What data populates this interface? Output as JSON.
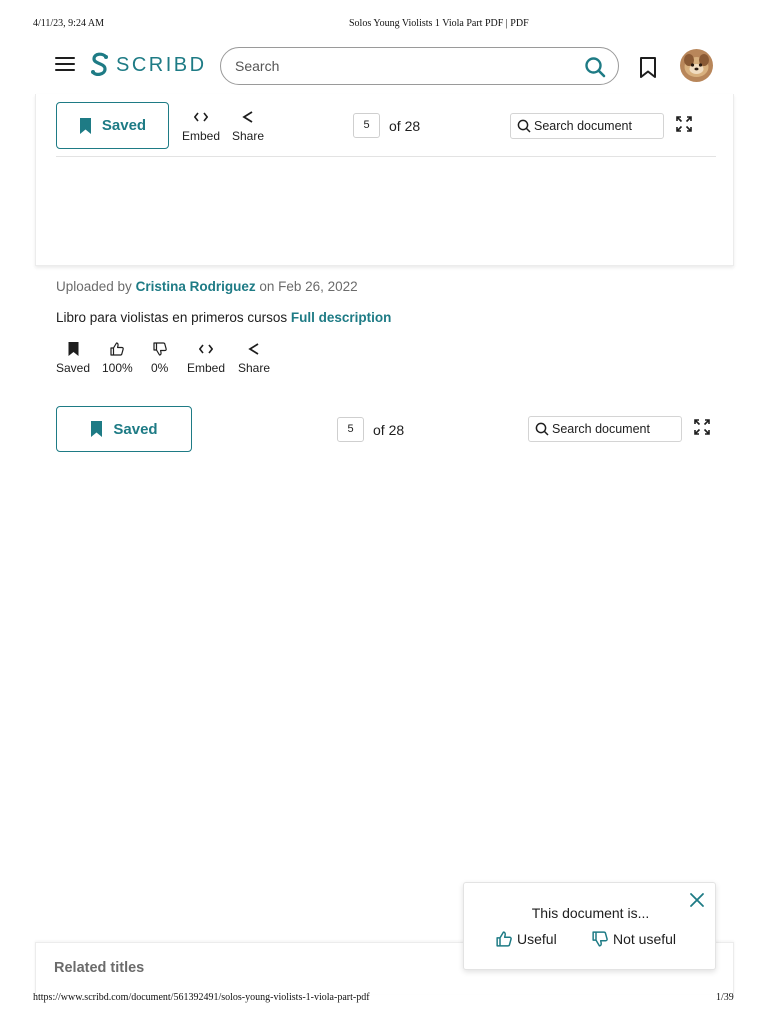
{
  "print_header": {
    "datetime": "4/11/23, 9:24 AM",
    "title": "Solos Young Violists 1 Viola Part PDF | PDF"
  },
  "print_footer": {
    "url": "https://www.scribd.com/document/561392491/solos-young-violists-1-viola-part-pdf",
    "page": "1/39"
  },
  "header": {
    "logo_text": "SCRIBD",
    "search_placeholder": "Search"
  },
  "toolbar_top": {
    "saved_label": "Saved",
    "embed_label": "Embed",
    "share_label": "Share",
    "page_current": "5",
    "page_total": "of 28",
    "search_doc_label": "Search document"
  },
  "meta": {
    "uploaded_prefix": "Uploaded by",
    "uploader": "Cristina Rodriguez",
    "date_text": "on Feb 26, 2022",
    "description": "Libro para violistas en primeros cursos",
    "full_description": "Full description"
  },
  "actions": {
    "saved": "Saved",
    "useful_pct": "100%",
    "not_useful_pct": "0%",
    "embed": "Embed",
    "share": "Share"
  },
  "toolbar_bottom": {
    "saved_label": "Saved",
    "page_current": "5",
    "page_total": "of 28",
    "search_doc_label": "Search document"
  },
  "feedback": {
    "title": "This document is...",
    "useful": "Useful",
    "not_useful": "Not useful"
  },
  "related": {
    "title": "Related titles"
  },
  "colors": {
    "brand": "#1e7b85",
    "text": "#1e1e1e",
    "muted": "#6b6b6b"
  }
}
